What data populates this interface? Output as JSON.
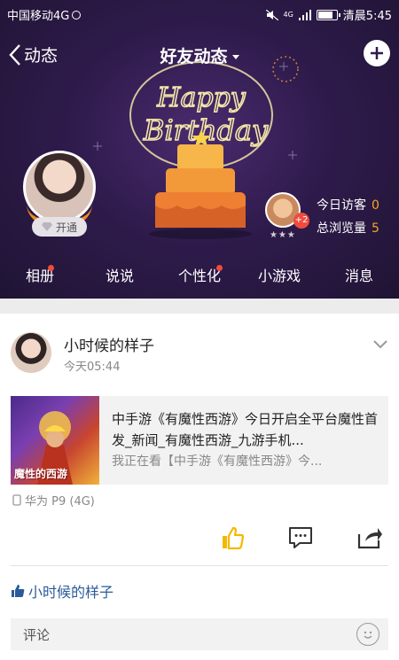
{
  "status_bar": {
    "carrier": "中国移动4G",
    "network_badge": "4G",
    "time": "清晨5:45",
    "battery_level": 0.85
  },
  "nav": {
    "back_label": "动态",
    "title": "好友动态"
  },
  "banner": {
    "art_text": [
      "Happy",
      "Birthday"
    ]
  },
  "profile": {
    "vip_label": "开通"
  },
  "visitors": {
    "badge": "+2",
    "today_label": "今日访客",
    "today_count": "0",
    "total_label": "总浏览量",
    "total_count": "5"
  },
  "tabs": [
    {
      "label": "相册",
      "dot": true
    },
    {
      "label": "说说",
      "dot": false
    },
    {
      "label": "个性化",
      "dot": true
    },
    {
      "label": "小游戏",
      "dot": false
    },
    {
      "label": "消息",
      "dot": false
    }
  ],
  "post": {
    "author": "小时候的样子",
    "time": "今天05:44",
    "share": {
      "title": "中手游《有魔性西游》今日开启全平台魔性首发_新闻_有魔性西游_九游手机...",
      "description": "我正在看【中手游《有魔性西游》今...",
      "thumb_text": "魔性的西游"
    },
    "device": "华为 P9 (4G)",
    "liked_by": "小时候的样子",
    "comment_placeholder": "评论"
  },
  "colors": {
    "banner": "#2f1b4c",
    "accent_orange": "#f5a623",
    "dot_red": "#f04b3c",
    "like_yellow": "#f5b800",
    "link_blue": "#2a5a9a"
  }
}
